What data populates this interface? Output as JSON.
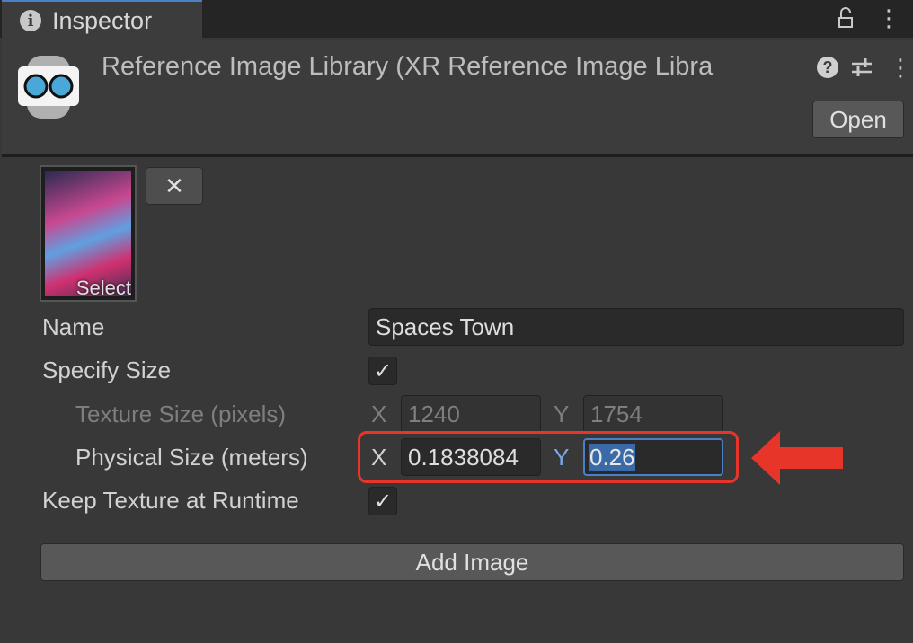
{
  "tab": {
    "label": "Inspector"
  },
  "header": {
    "title": "Reference Image Library (XR Reference Image Libra",
    "open_label": "Open"
  },
  "image": {
    "select_label": "Select",
    "remove_label": "✕"
  },
  "fields": {
    "name_label": "Name",
    "name_value": "Spaces Town",
    "specify_size_label": "Specify Size",
    "specify_size_checked": true,
    "texture_size_label": "Texture Size (pixels)",
    "texture_x_label": "X",
    "texture_x": "1240",
    "texture_y_label": "Y",
    "texture_y": "1754",
    "physical_size_label": "Physical Size (meters)",
    "physical_x_label": "X",
    "physical_x": "0.1838084",
    "physical_y_label": "Y",
    "physical_y": "0.26",
    "keep_texture_label": "Keep Texture at Runtime",
    "keep_texture_checked": true
  },
  "add_image_label": "Add Image",
  "colors": {
    "highlight": "#e8352a",
    "accent": "#4a80c8"
  }
}
